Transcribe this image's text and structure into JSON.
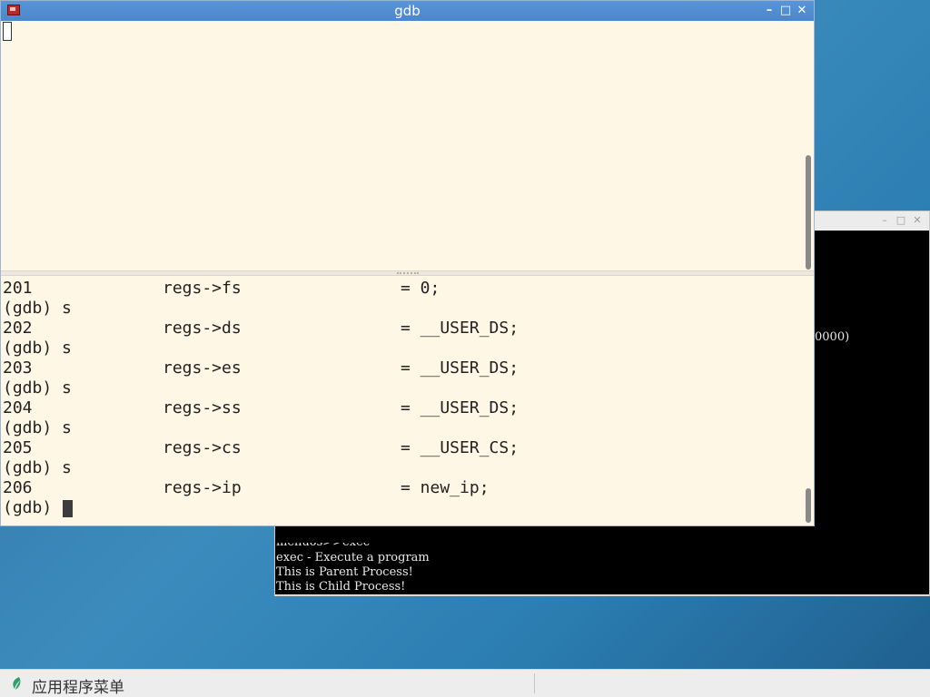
{
  "gdb_window": {
    "title": "gdb",
    "controls": {
      "minimize": "–",
      "maximize": "□",
      "close": "✕"
    },
    "output": [
      {
        "line": "201",
        "reg": "regs->fs",
        "value": "= 0;"
      },
      {
        "prompt": "(gdb) s"
      },
      {
        "line": "202",
        "reg": "regs->ds",
        "value": "= __USER_DS;"
      },
      {
        "prompt": "(gdb) s"
      },
      {
        "line": "203",
        "reg": "regs->es",
        "value": "= __USER_DS;"
      },
      {
        "prompt": "(gdb) s"
      },
      {
        "line": "204",
        "reg": "regs->ss",
        "value": "= __USER_DS;"
      },
      {
        "prompt": "(gdb) s"
      },
      {
        "line": "205",
        "reg": "regs->cs",
        "value": "= __USER_CS;"
      },
      {
        "prompt": "(gdb) s"
      },
      {
        "line": "206",
        "reg": "regs->ip",
        "value": "= new_ip;"
      }
    ],
    "current_prompt": "(gdb)"
  },
  "console_window": {
    "controls": {
      "minimize": "–",
      "maximize": "□",
      "close": "✕"
    },
    "partial_text": "0000)",
    "lines": [
      "menuos>>exec",
      "exec - Execute a program",
      "This is Parent Process!",
      "This is Child Process!"
    ]
  },
  "taskbar": {
    "menu_label": "应用程序菜单",
    "menu_icon": "leaf-icon"
  }
}
